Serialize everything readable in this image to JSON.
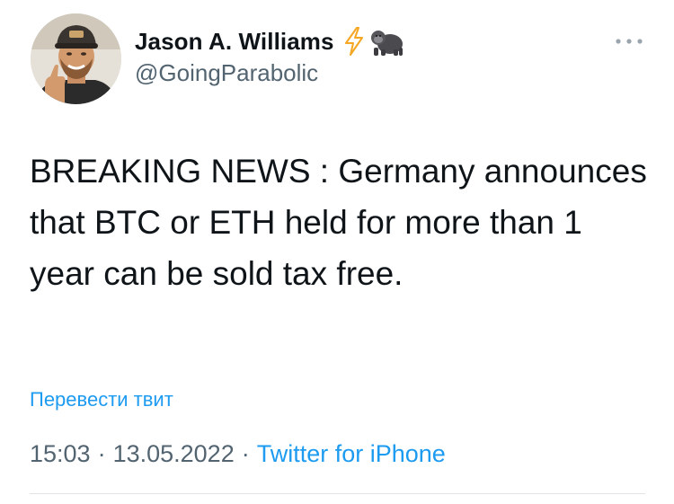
{
  "tweet": {
    "author": {
      "display_name": "Jason A. Williams",
      "handle": "@GoingParabolic",
      "name_emojis": [
        "bolt-icon",
        "gorilla-icon"
      ]
    },
    "text": "BREAKING NEWS : Germany announces that BTC or ETH held for more than 1 year can be sold tax free.",
    "translate_label": "Перевести твит",
    "time": "15:03",
    "date": "13.05.2022",
    "source": "Twitter for iPhone",
    "separator": "·",
    "more_label": "•••"
  },
  "colors": {
    "text": "#0f1419",
    "secondary": "#536471",
    "link": "#1d9bf0",
    "bolt": "#f5a623",
    "divider": "#dfe3e6"
  }
}
